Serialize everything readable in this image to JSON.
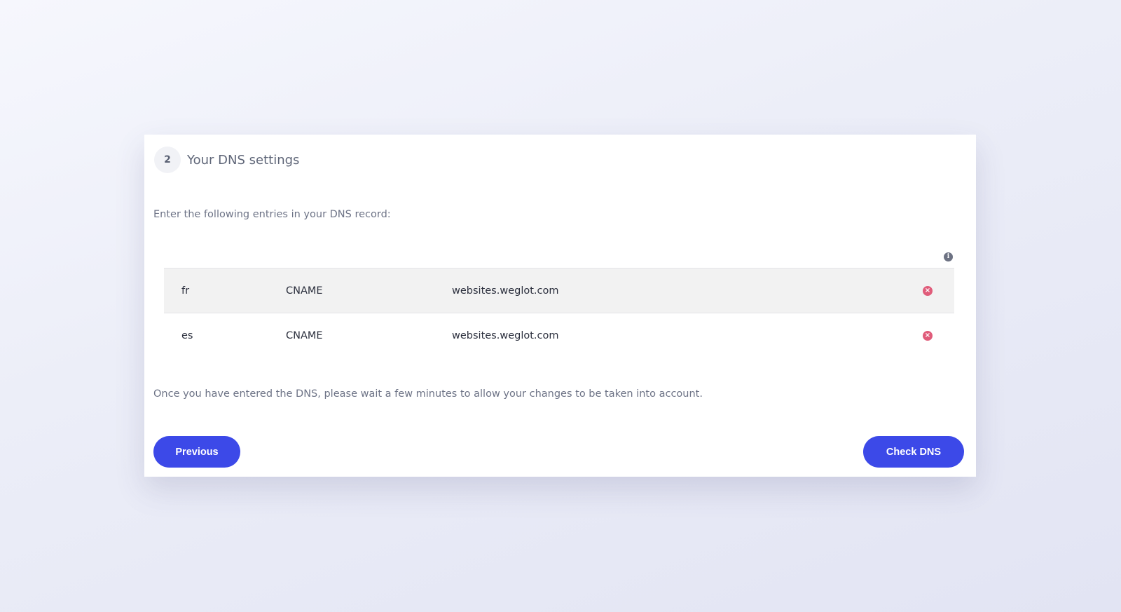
{
  "step": {
    "number": "2",
    "title": "Your DNS settings"
  },
  "instruction": "Enter the following entries in your DNS record:",
  "info_icon": "i",
  "dns_records": [
    {
      "host": "fr",
      "type": "CNAME",
      "value": "websites.weglot.com"
    },
    {
      "host": "es",
      "type": "CNAME",
      "value": "websites.weglot.com"
    }
  ],
  "remove_icon": "×",
  "note": "Once you have entered the DNS, please wait a few minutes to allow your changes to be taken into account.",
  "buttons": {
    "previous": "Previous",
    "check": "Check DNS"
  },
  "colors": {
    "primary": "#3c49e8",
    "danger": "#e05c7a",
    "row_highlight": "#f2f2f2"
  }
}
